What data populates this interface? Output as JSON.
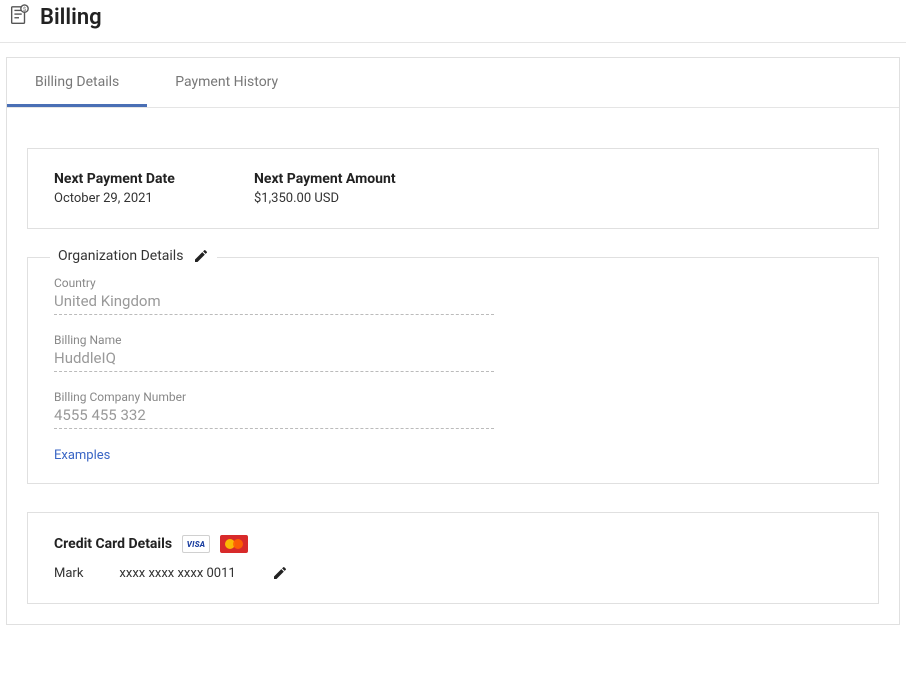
{
  "header": {
    "title": "Billing"
  },
  "tabs": {
    "items": [
      {
        "label": "Billing Details"
      },
      {
        "label": "Payment History"
      }
    ]
  },
  "summary": {
    "next_payment_date_label": "Next Payment Date",
    "next_payment_date_value": "October 29, 2021",
    "next_payment_amount_label": "Next Payment Amount",
    "next_payment_amount_value": "$1,350.00 USD"
  },
  "org_details": {
    "legend": "Organization Details",
    "country_label": "Country",
    "country_value": "United Kingdom",
    "billing_name_label": "Billing Name",
    "billing_name_value": "HuddleIQ",
    "company_number_label": "Billing Company Number",
    "company_number_value": "4555 455 332",
    "examples_link": "Examples"
  },
  "credit_card": {
    "title": "Credit Card Details",
    "visa_label": "VISA",
    "holder_name": "Mark",
    "masked_number": "xxxx xxxx xxxx 0011"
  }
}
